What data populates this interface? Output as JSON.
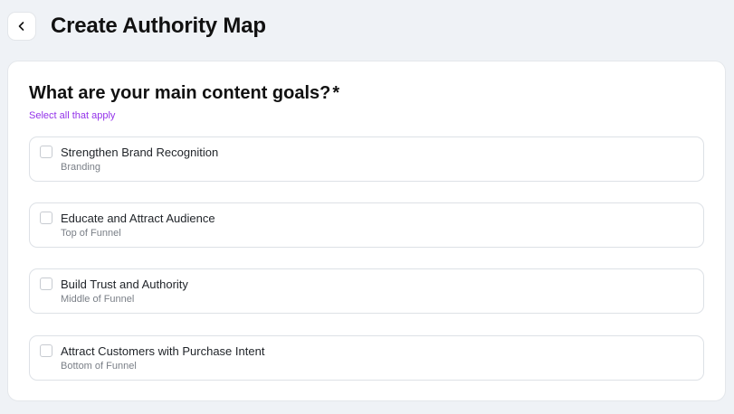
{
  "header": {
    "back_icon": "chevron-left-icon",
    "title": "Create Authority Map"
  },
  "form": {
    "question": "What are your main content goals?",
    "required_marker": "*",
    "helper": "Select all that apply",
    "options": [
      {
        "label": "Strengthen Brand Recognition",
        "sublabel": "Branding",
        "checked": false
      },
      {
        "label": "Educate and Attract Audience",
        "sublabel": "Top of Funnel",
        "checked": false
      },
      {
        "label": "Build Trust and Authority",
        "sublabel": "Middle of Funnel",
        "checked": false
      },
      {
        "label": "Attract Customers with Purchase Intent",
        "sublabel": "Bottom of Funnel",
        "checked": false
      }
    ]
  },
  "colors": {
    "background": "#eff2f6",
    "card": "#ffffff",
    "accent_purple": "#9333ea",
    "text_primary": "#111111",
    "text_secondary": "#7a7f87"
  }
}
